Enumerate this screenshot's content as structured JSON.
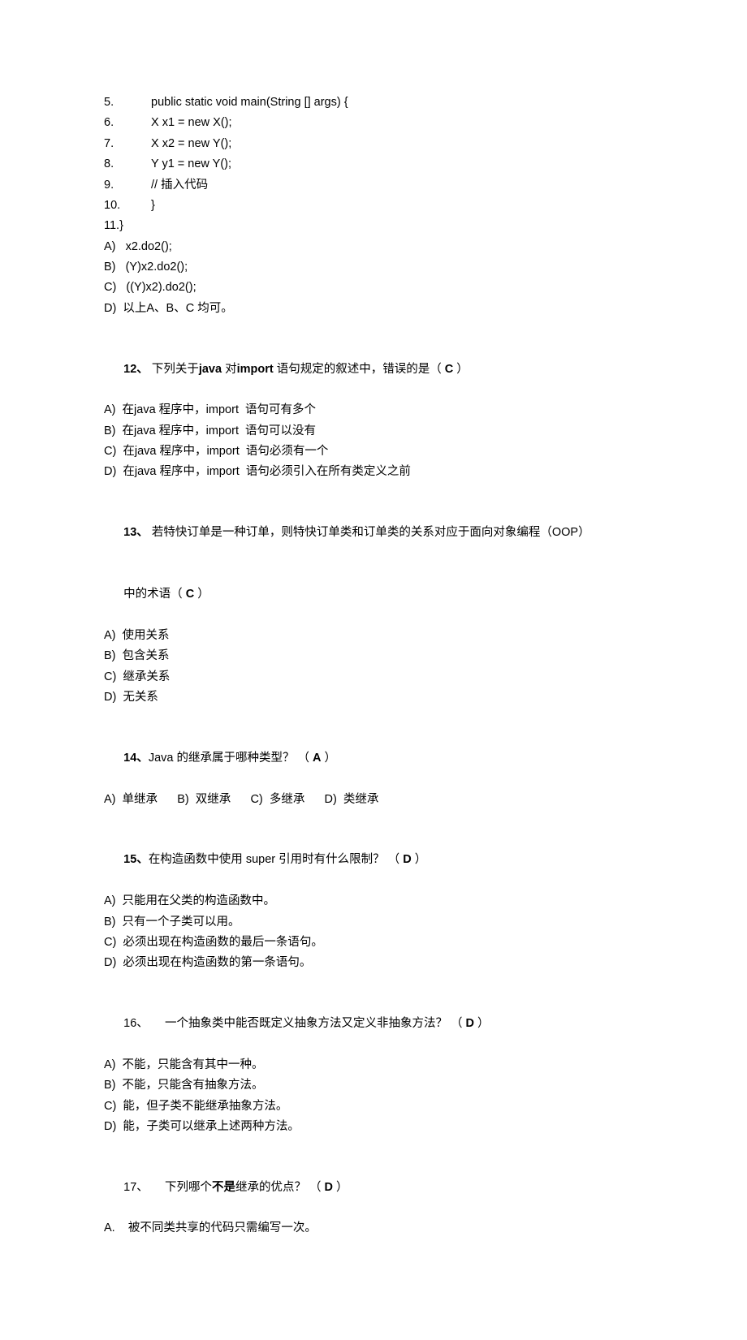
{
  "codeLines": [
    {
      "num": "5.",
      "indent": "          ",
      "text": "public static void main(String [] args) {"
    },
    {
      "num": "6.",
      "indent": "                    ",
      "text": "X x1 = new X();"
    },
    {
      "num": "7.",
      "indent": "                    ",
      "text": "X x2 = new Y();"
    },
    {
      "num": "8.",
      "indent": "                    ",
      "text": "Y y1 = new Y();"
    },
    {
      "num": "9.",
      "indent": "                    ",
      "text": "// 插入代码"
    },
    {
      "num": "10.",
      "indent": "          ",
      "text": "}"
    },
    {
      "num": "11.}",
      "indent": "",
      "text": ""
    }
  ],
  "q11_options": [
    "A)   x2.do2();",
    "B)   (Y)x2.do2();",
    "C)   ((Y)x2).do2();",
    "D)  以上A、B、C 均可。"
  ],
  "q12": {
    "num": "12、",
    "prefix": " 下列关于",
    "bold1": "java",
    "mid": " 对",
    "bold2": "import",
    "suffix1": " 语句规定的叙述中，错误的是（ ",
    "ans": "C",
    "suffix2": " ）",
    "options": [
      "A)  在java 程序中，import  语句可有多个",
      "B)  在java 程序中，import  语句可以没有",
      "C)  在java 程序中，import  语句必须有一个",
      "D)  在java 程序中，import  语句必须引入在所有类定义之前"
    ]
  },
  "q13": {
    "num": "13、",
    "line1": " 若特快订单是一种订单，则特快订单类和订单类的关系对应于面向对象编程（OOP）",
    "line2a": "中的术语（ ",
    "ans": "C",
    "line2b": " ）",
    "options": [
      "A)  使用关系",
      "B)  包含关系",
      "C)  继承关系",
      "D)  无关系"
    ]
  },
  "q14": {
    "num": "14、",
    "text1": "Java 的继承属于哪种类型？ （ ",
    "ans": "A",
    "text2": " ）",
    "options": "A)  单继承      B)  双继承      C)  多继承      D)  类继承"
  },
  "q15": {
    "num": "15、",
    "text1": "在构造函数中使用 super 引用时有什么限制？ （ ",
    "ans": "D",
    "text2": " ）",
    "options": [
      "A)  只能用在父类的构造函数中。",
      "B)  只有一个子类可以用。",
      "C)  必须出现在构造函数的最后一条语句。",
      "D)  必须出现在构造函数的第一条语句。"
    ]
  },
  "q16": {
    "num": "16、",
    "text1": "一个抽象类中能否既定义抽象方法又定义非抽象方法？ （ ",
    "ans": "D",
    "text2": " ）",
    "options": [
      "A)  不能，只能含有其中一种。",
      "B)  不能，只能含有抽象方法。",
      "C)  能，但子类不能继承抽象方法。",
      "D)  能，子类可以继承上述两种方法。"
    ]
  },
  "q17": {
    "num": "17、",
    "prefix": "下列哪个",
    "bold": "不是",
    "suffix1": "继承的优点？ （ ",
    "ans": "D",
    "suffix2": " ）",
    "options": [
      "A.    被不同类共享的代码只需编写一次。"
    ]
  }
}
